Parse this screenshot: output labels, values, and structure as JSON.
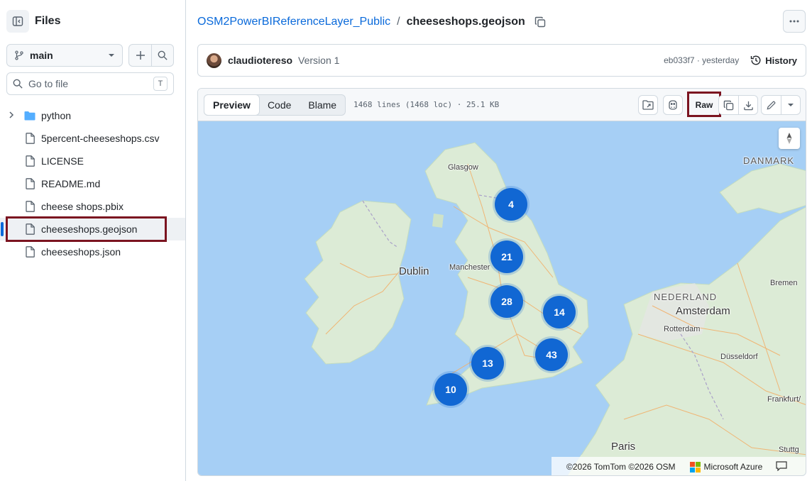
{
  "sidebar": {
    "title": "Files",
    "branch": "main",
    "goto_placeholder": "Go to file",
    "goto_shortcut": "T",
    "items": [
      {
        "label": "python",
        "type": "folder"
      },
      {
        "label": "5percent-cheeseshops.csv",
        "type": "file"
      },
      {
        "label": "LICENSE",
        "type": "file"
      },
      {
        "label": "README.md",
        "type": "file"
      },
      {
        "label": "cheese shops.pbix",
        "type": "file"
      },
      {
        "label": "cheeseshops.geojson",
        "type": "file",
        "active": true
      },
      {
        "label": "cheeseshops.json",
        "type": "file"
      }
    ]
  },
  "breadcrumb": {
    "repo": "OSM2PowerBIReferenceLayer_Public",
    "separator": "/",
    "file": "cheeseshops.geojson"
  },
  "commit": {
    "author": "claudiotereso",
    "version": "Version 1",
    "sha_time": "eb033f7 · yesterday",
    "history_label": "History"
  },
  "file_toolbar": {
    "tabs": [
      "Preview",
      "Code",
      "Blame"
    ],
    "selected_tab": "Preview",
    "info": "1468 lines (1468 loc) · 25.1 KB",
    "raw_label": "Raw"
  },
  "map": {
    "places": {
      "glasgow": "Glasgow",
      "dublin": "Dublin",
      "manchester": "Manchester",
      "amsterdam": "Amsterdam",
      "rotterdam": "Rotterdam",
      "nederland": "NEDERLAND",
      "danmark": "DANMARK",
      "bremen": "Bremen",
      "dusseldorf": "Düsseldorf",
      "frankfurt": "Frankfurt/",
      "paris": "Paris",
      "stuttgart": "Stuttg"
    },
    "clusters": [
      "4",
      "21",
      "28",
      "14",
      "43",
      "13",
      "10"
    ],
    "attribution": "©2026 TomTom ©2026 OSM",
    "provider": "Microsoft Azure"
  },
  "colors": {
    "accent": "#0969da",
    "highlight_box": "#7b1420",
    "cluster": "#1167d3",
    "sea": "#a6cff5",
    "land": "#dcebd6"
  }
}
